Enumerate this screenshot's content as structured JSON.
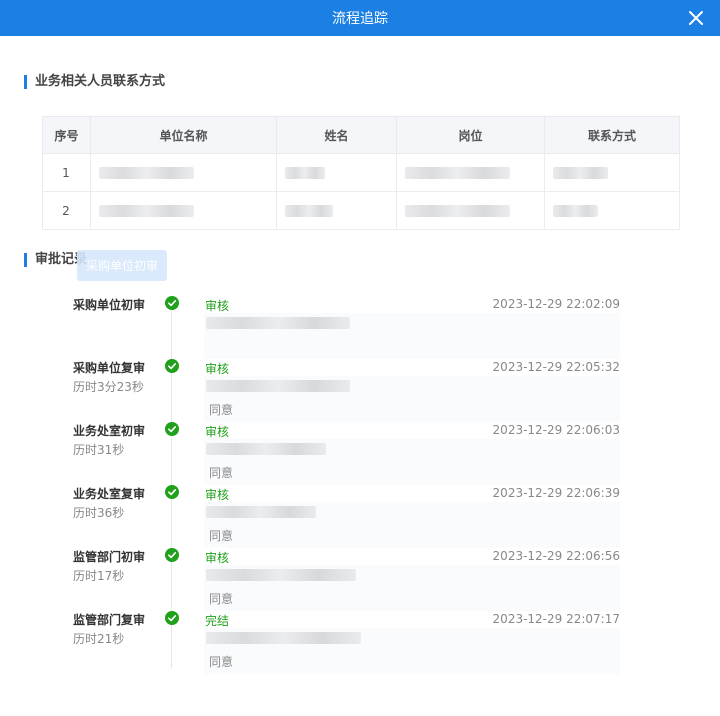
{
  "dialog": {
    "title": "流程追踪"
  },
  "contacts": {
    "title": "业务相关人员联系方式",
    "headers": [
      "序号",
      "单位名称",
      "姓名",
      "岗位",
      "联系方式"
    ],
    "rows": [
      {
        "index": "1"
      },
      {
        "index": "2"
      }
    ]
  },
  "records": {
    "title": "审批记录",
    "ghost_tag": "采购单位初审",
    "steps": [
      {
        "node": "采购单位初审",
        "duration": "",
        "status": "审核",
        "time": "2023-12-29 22:02:09",
        "opinion": ""
      },
      {
        "node": "采购单位复审",
        "duration": "历时3分23秒",
        "status": "审核",
        "time": "2023-12-29 22:05:32",
        "opinion": "同意"
      },
      {
        "node": "业务处室初审",
        "duration": "历时31秒",
        "status": "审核",
        "time": "2023-12-29 22:06:03",
        "opinion": "同意"
      },
      {
        "node": "业务处室复审",
        "duration": "历时36秒",
        "status": "审核",
        "time": "2023-12-29 22:06:39",
        "opinion": "同意"
      },
      {
        "node": "监管部门初审",
        "duration": "历时17秒",
        "status": "审核",
        "time": "2023-12-29 22:06:56",
        "opinion": "同意"
      },
      {
        "node": "监管部门复审",
        "duration": "历时21秒",
        "status": "完结",
        "time": "2023-12-29 22:07:17",
        "opinion": "同意"
      }
    ]
  },
  "colors": {
    "header": "#1b7fe4",
    "success": "#21a01c"
  },
  "icons": {
    "close": "close-icon",
    "check": "check-circle-icon"
  }
}
